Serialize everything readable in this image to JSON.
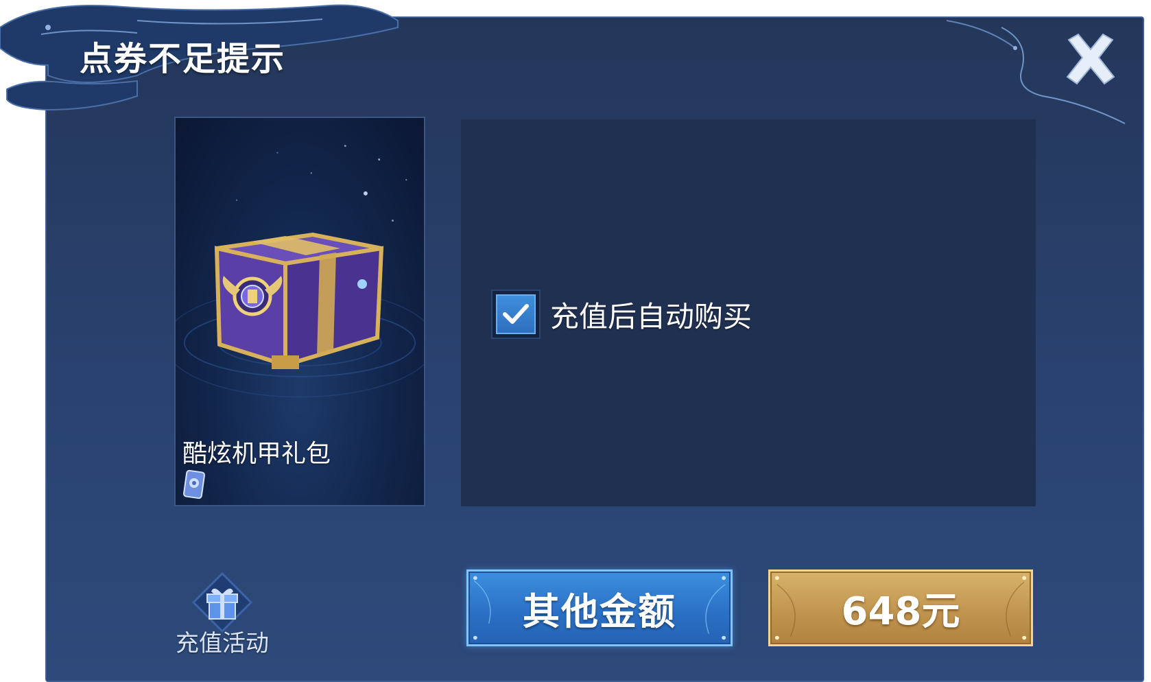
{
  "dialog": {
    "title": "点券不足提示",
    "close_icon": "close-x-icon"
  },
  "item": {
    "name": "酷炫机甲礼包",
    "image_icon": "treasure-chest-icon",
    "currency_icon": "coupon-card-icon"
  },
  "options": {
    "auto_buy_label": "充值后自动购买",
    "auto_buy_checked": true
  },
  "activity": {
    "label": "充值活动",
    "icon": "gift-box-icon"
  },
  "buttons": {
    "other_amount_label": "其他金额",
    "price_label": "648元"
  },
  "colors": {
    "panel_bg": "#2a4270",
    "info_bg": "#203050",
    "blue_button": "#2a6fc4",
    "gold_button": "#c19550",
    "checkbox_fill": "#3f8fdc"
  }
}
